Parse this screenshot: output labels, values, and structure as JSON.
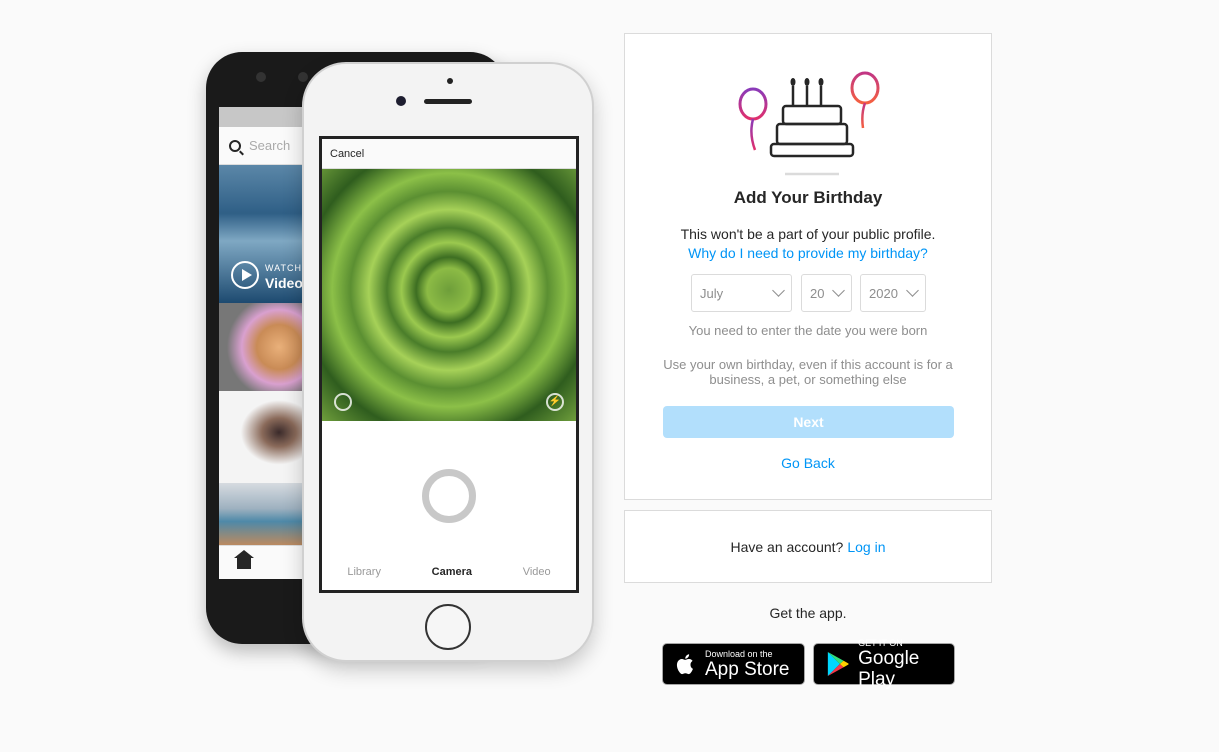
{
  "phones": {
    "back_search_placeholder": "Search",
    "back_watch": "WATCH",
    "back_video": "Video",
    "front_cancel": "Cancel",
    "front_tabs": [
      "Library",
      "Camera",
      "Video"
    ]
  },
  "birthday": {
    "title": "Add Your Birthday",
    "not_public": "This won't be a part of your public profile.",
    "why_link": "Why do I need to provide my birthday?",
    "month": "July",
    "day": "20",
    "year": "2020",
    "hint": "You need to enter the date you were born",
    "own_birthday": "Use your own birthday, even if this account is for a business, a pet, or something else",
    "next_label": "Next",
    "go_back_label": "Go Back"
  },
  "account": {
    "prompt": "Have an account?",
    "login_label": "Log in"
  },
  "get_app": {
    "label": "Get the app.",
    "apple_small": "Download on the",
    "apple_big": "App Store",
    "google_small": "GET IT ON",
    "google_big": "Google Play"
  },
  "colors": {
    "link": "#0095f6",
    "next_disabled": "#b2dffc",
    "balloon_left": "#c13584",
    "balloon_right": "#e1306c"
  }
}
